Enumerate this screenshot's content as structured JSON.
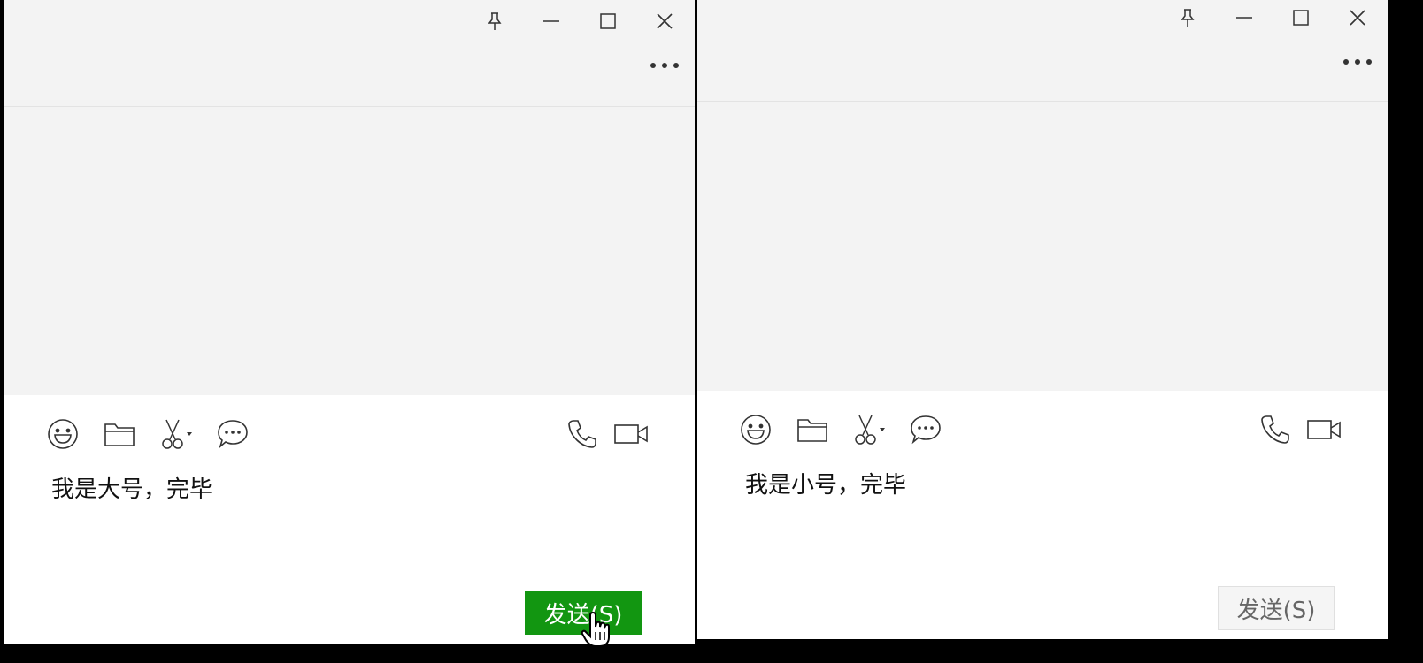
{
  "windows": [
    {
      "id": "left",
      "input_text": "我是大号，完毕",
      "send_label": "发送(S)",
      "send_state": "enabled"
    },
    {
      "id": "right",
      "input_text": "我是小号，完毕",
      "send_label": "发送(S)",
      "send_state": "disabled"
    }
  ],
  "titlebar_buttons": [
    "pin-icon",
    "minimize-icon",
    "maximize-icon",
    "close-icon",
    "more-icon"
  ],
  "toolbar_icons_left": [
    "emoji-icon",
    "folder-icon",
    "scissors-icon",
    "chat-history-icon"
  ],
  "toolbar_icons_right": [
    "phone-icon",
    "video-icon"
  ],
  "colors": {
    "send_active_bg": "#129611",
    "send_inactive_bg": "#f5f5f5",
    "panel_bg": "#f3f3f3",
    "input_bg": "#ffffff",
    "separator": "#000000"
  }
}
